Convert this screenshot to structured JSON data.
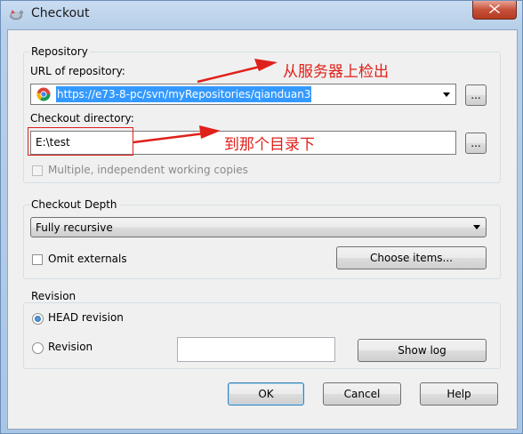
{
  "window": {
    "title": "Checkout"
  },
  "repository": {
    "group_label": "Repository",
    "url_label": "URL of repository:",
    "url_value": "https://e73-8-pc/svn/myRepositories/qianduan3",
    "browse_label": "...",
    "dir_label": "Checkout directory:",
    "dir_value": "E:\\test",
    "dir_browse_label": "...",
    "multiple_label": "Multiple, independent working copies"
  },
  "depth": {
    "group_label": "Checkout Depth",
    "selected": "Fully recursive",
    "omit_externals_label": "Omit externals",
    "choose_items_label": "Choose items..."
  },
  "revision": {
    "group_label": "Revision",
    "head_label": "HEAD revision",
    "revision_label": "Revision",
    "revision_value": "",
    "show_log_label": "Show log"
  },
  "buttons": {
    "ok": "OK",
    "cancel": "Cancel",
    "help": "Help"
  },
  "annotations": {
    "checkout_from_server": "从服务器上检出",
    "to_which_directory": "到那个目录下"
  },
  "colors": {
    "annotation": "#e0201a",
    "selection": "#3399ff"
  }
}
